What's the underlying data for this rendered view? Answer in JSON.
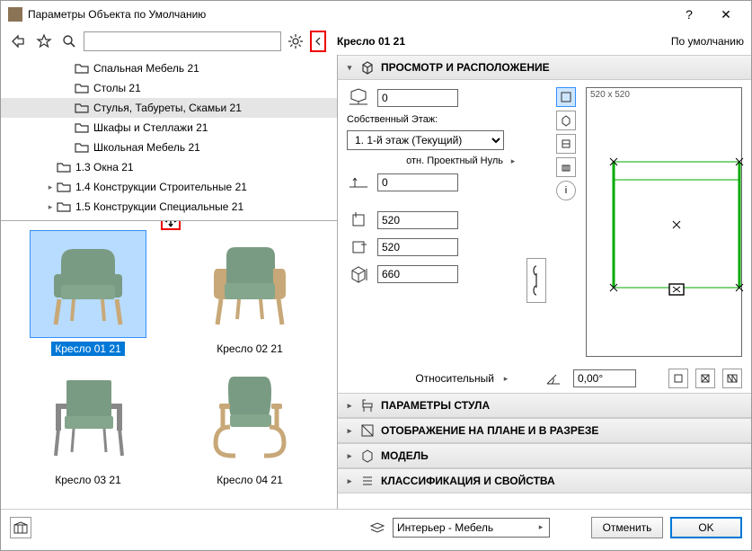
{
  "title": "Параметры Объекта по Умолчанию",
  "help_btn": "?",
  "close_btn": "✕",
  "object_name": "Кресло 01 21",
  "default_label": "По умолчанию",
  "tree": [
    {
      "indent": 68,
      "label": "Спальная Мебель 21",
      "exp": ""
    },
    {
      "indent": 68,
      "label": "Столы 21",
      "exp": ""
    },
    {
      "indent": 68,
      "label": "Стулья, Табуреты, Скамьи 21",
      "exp": "",
      "selected": true
    },
    {
      "indent": 68,
      "label": "Шкафы и Стеллажи 21",
      "exp": ""
    },
    {
      "indent": 68,
      "label": "Школьная Мебель 21",
      "exp": ""
    },
    {
      "indent": 48,
      "label": "1.3 Окна 21",
      "exp": ""
    },
    {
      "indent": 48,
      "label": "1.4 Конструкции Строительные 21",
      "exp": "▸"
    },
    {
      "indent": 48,
      "label": "1.5 Конструкции Специальные 21",
      "exp": "▸"
    }
  ],
  "grid_items": [
    {
      "label": "Кресло 01 21",
      "selected": true
    },
    {
      "label": "Кресло 02 21",
      "selected": false
    },
    {
      "label": "Кресло 03 21",
      "selected": false
    },
    {
      "label": "Кресло 04 21",
      "selected": false
    }
  ],
  "sections": {
    "preview": "ПРОСМОТР И РАСПОЛОЖЕНИЕ",
    "chair": "ПАРАМЕТРЫ СТУЛА",
    "display": "ОТОБРАЖЕНИЕ НА ПЛАНЕ И В РАЗРЕЗЕ",
    "model": "МОДЕЛЬ",
    "class": "КЛАССИФИКАЦИЯ И СВОЙСТВА"
  },
  "params": {
    "elevation": "0",
    "floor_label": "Собственный Этаж:",
    "floor_value": "1. 1-й этаж (Текущий)",
    "proj_null_label": "отн. Проектный Нуль",
    "proj_null": "0",
    "width": "520",
    "depth": "520",
    "height": "660",
    "preview_dims": "520 x 520",
    "relative_label": "Относительный",
    "angle": "0,00°"
  },
  "layer": "Интерьер - Мебель",
  "buttons": {
    "cancel": "Отменить",
    "ok": "OK"
  }
}
